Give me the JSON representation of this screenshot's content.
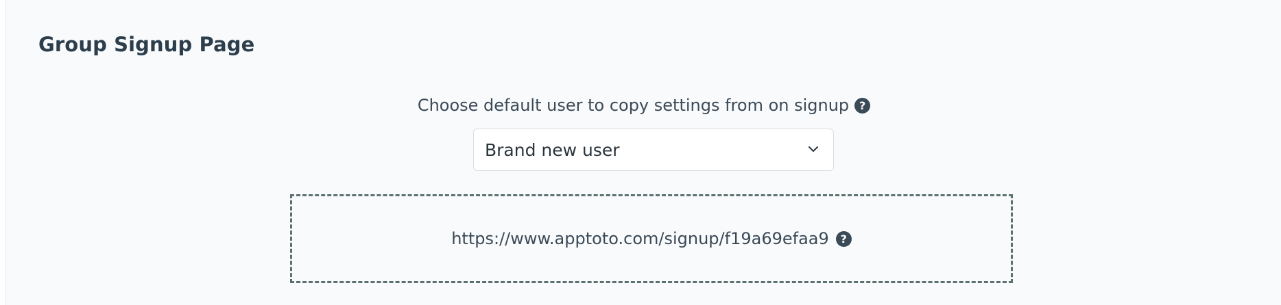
{
  "section": {
    "title": "Group Signup Page"
  },
  "default_user": {
    "label": "Choose default user to copy settings from on signup",
    "help_icon": "?",
    "selected_value": "Brand new user"
  },
  "signup_link": {
    "url": "https://www.apptoto.com/signup/f19a69efaa9",
    "help_icon": "?"
  },
  "colors": {
    "title": "#2c3e4c",
    "text": "#3b4a57",
    "dashed_border": "#5d7070",
    "panel_background": "#f8fafb"
  },
  "icons": {
    "help": "question-circle-icon",
    "dropdown": "chevron-down-icon"
  }
}
